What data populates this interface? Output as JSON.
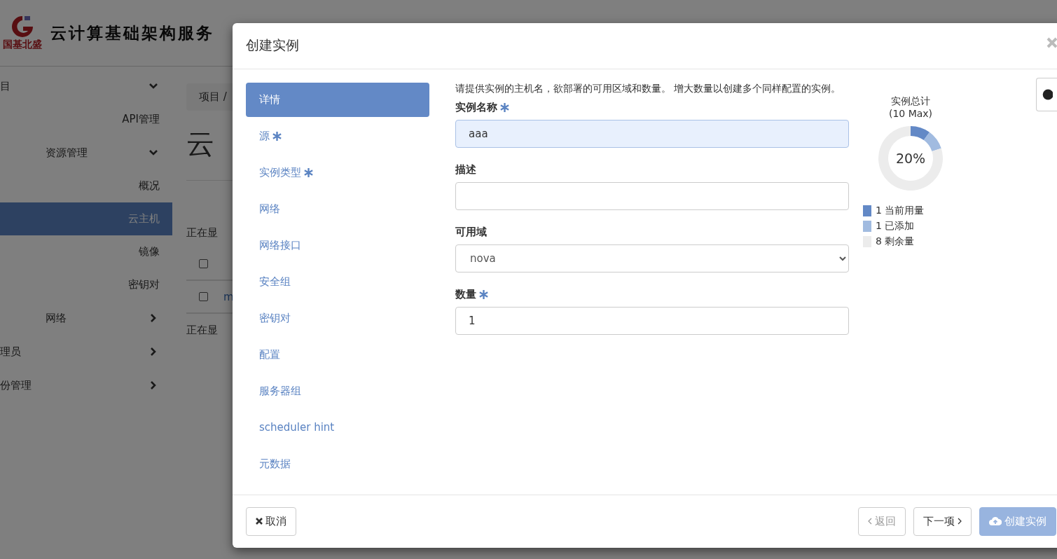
{
  "header": {
    "logo_text": "国基北盛",
    "title": "云计算基础架构服务"
  },
  "sidebar": {
    "items": [
      {
        "label": "目",
        "expanded": true,
        "children": [
          {
            "label": "API管理",
            "selected": false
          },
          {
            "label": "资源管理",
            "expanded": true,
            "children": [
              {
                "label": "概况",
                "selected": false
              },
              {
                "label": "云主机",
                "selected": true
              },
              {
                "label": "镜像",
                "selected": false
              },
              {
                "label": "密钥对",
                "selected": false
              }
            ]
          },
          {
            "label": "网络",
            "expanded": false
          }
        ]
      },
      {
        "label": "理员",
        "expanded": false
      },
      {
        "label": "份管理",
        "expanded": false
      }
    ]
  },
  "content": {
    "breadcrumb": "项目 /",
    "heading": "云",
    "showing_top": "正在显",
    "showing_bottom": "正在显",
    "rows": [
      {
        "checked": false
      },
      {
        "checked": false,
        "cell": "m"
      }
    ]
  },
  "modal": {
    "title": "创建实例",
    "steps": [
      {
        "label": "详情",
        "required": false,
        "selected": true
      },
      {
        "label": "源",
        "required": true,
        "selected": false
      },
      {
        "label": "实例类型",
        "required": true,
        "selected": false
      },
      {
        "label": "网络",
        "required": false,
        "selected": false
      },
      {
        "label": "网络接口",
        "required": false,
        "selected": false
      },
      {
        "label": "安全组",
        "required": false,
        "selected": false
      },
      {
        "label": "密钥对",
        "required": false,
        "selected": false
      },
      {
        "label": "配置",
        "required": false,
        "selected": false
      },
      {
        "label": "服务器组",
        "required": false,
        "selected": false
      },
      {
        "label": "scheduler hint",
        "required": false,
        "selected": false
      },
      {
        "label": "元数据",
        "required": false,
        "selected": false
      }
    ],
    "intro": "请提供实例的主机名，欲部署的可用区域和数量。 增大数量以创建多个同样配置的实例。",
    "fields": [
      {
        "kind": "text",
        "label": "实例名称",
        "required": true,
        "value": "aaa",
        "focused": true
      },
      {
        "kind": "text",
        "label": "描述",
        "required": false,
        "focused": false
      },
      {
        "kind": "select",
        "label": "可用域",
        "required": false,
        "value": "nova",
        "focused": false
      },
      {
        "kind": "text",
        "label": "数量",
        "required": true,
        "value": "1",
        "focused": false
      }
    ],
    "quota": {
      "subtitle": "(10 Max)",
      "center": "20%",
      "legend": [
        {
          "count": "1",
          "color": "#6389c6"
        },
        {
          "count": "1",
          "color": "#a1bbe0"
        },
        {
          "count": "8",
          "color": "#ececec"
        }
      ],
      "chart_data": {
        "type": "donut",
        "title": "实例总计",
        "categories": [
          "当前用量",
          "已添加",
          "剩余量"
        ],
        "values": [
          10,
          10,
          80
        ]
      }
    },
    "buttons": [
      {
        "kind": "cancel",
        "label": "取消",
        "disabled": false
      },
      {
        "kind": "back",
        "label": "返回",
        "disabled": true
      },
      {
        "kind": "next",
        "label": "下一项",
        "disabled": false
      },
      {
        "kind": "create",
        "label": "创建实例",
        "disabled": true
      }
    ]
  }
}
